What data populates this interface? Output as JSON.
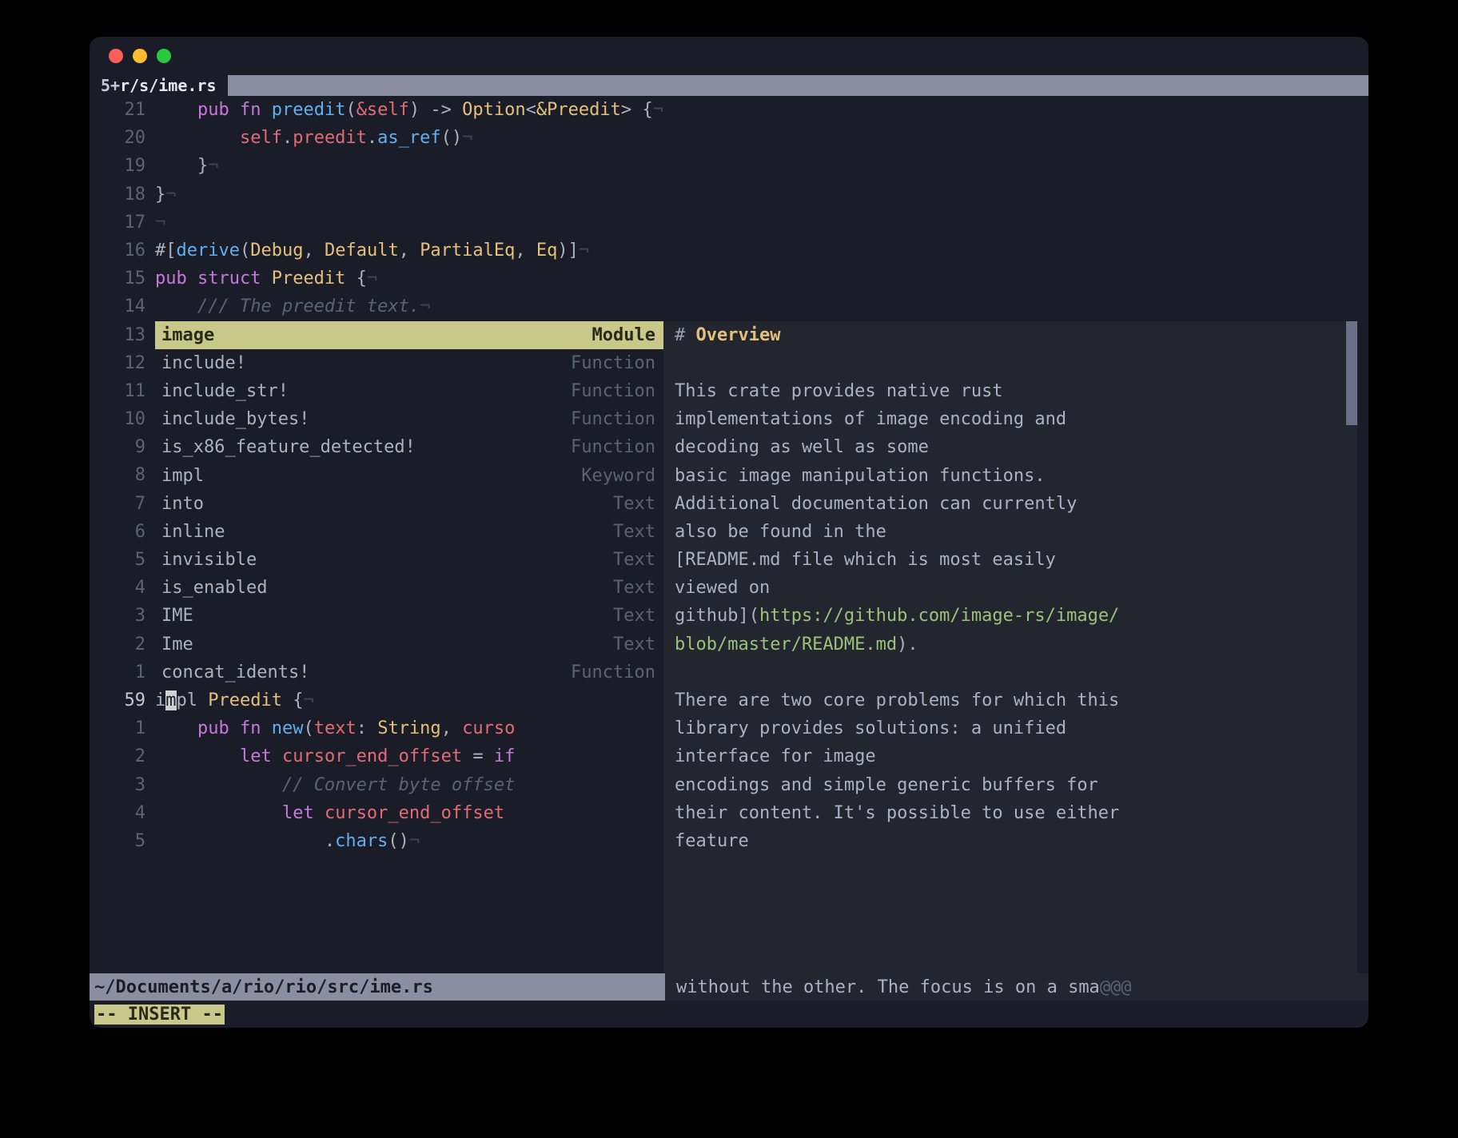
{
  "tab": {
    "prefix": "5+ ",
    "path": "r/s/ime.rs"
  },
  "code": {
    "before": [
      {
        "n": "21",
        "tokens": [
          [
            "plain",
            "    "
          ],
          [
            "kw",
            "pub fn"
          ],
          [
            "plain",
            " "
          ],
          [
            "fn",
            "preedit"
          ],
          [
            "punct",
            "("
          ],
          [
            "self",
            "&self"
          ],
          [
            "punct",
            ") -> "
          ],
          [
            "type",
            "Option"
          ],
          [
            "punct",
            "<"
          ],
          [
            "type",
            "&Preedit"
          ],
          [
            "punct",
            "> {"
          ],
          [
            "wspace",
            "¬"
          ]
        ]
      },
      {
        "n": "20",
        "tokens": [
          [
            "plain",
            "        "
          ],
          [
            "self",
            "self"
          ],
          [
            "punct",
            "."
          ],
          [
            "ident",
            "preedit"
          ],
          [
            "punct",
            "."
          ],
          [
            "fn",
            "as_ref"
          ],
          [
            "punct",
            "()"
          ],
          [
            "wspace",
            "¬"
          ]
        ]
      },
      {
        "n": "19",
        "tokens": [
          [
            "plain",
            "    }"
          ],
          [
            "wspace",
            "¬"
          ]
        ]
      },
      {
        "n": "18",
        "tokens": [
          [
            "plain",
            "}"
          ],
          [
            "wspace",
            "¬"
          ]
        ]
      },
      {
        "n": "17",
        "tokens": [
          [
            "wspace",
            "¬"
          ]
        ]
      },
      {
        "n": "16",
        "tokens": [
          [
            "punct",
            "#["
          ],
          [
            "fn",
            "derive"
          ],
          [
            "punct",
            "("
          ],
          [
            "type",
            "Debug"
          ],
          [
            "punct",
            ", "
          ],
          [
            "type",
            "Default"
          ],
          [
            "punct",
            ", "
          ],
          [
            "type",
            "PartialEq"
          ],
          [
            "punct",
            ", "
          ],
          [
            "type",
            "Eq"
          ],
          [
            "punct",
            ")]"
          ],
          [
            "wspace",
            "¬"
          ]
        ]
      },
      {
        "n": "15",
        "tokens": [
          [
            "kw",
            "pub struct"
          ],
          [
            "plain",
            " "
          ],
          [
            "type",
            "Preedit"
          ],
          [
            "plain",
            " {"
          ],
          [
            "wspace",
            "¬"
          ]
        ]
      },
      {
        "n": "14",
        "tokens": [
          [
            "plain",
            "    "
          ],
          [
            "comment",
            "/// The preedit text."
          ],
          [
            "wspace",
            "¬"
          ]
        ]
      }
    ],
    "current": {
      "n": "59",
      "prefix": "i",
      "cursor": "m",
      "rest_tokens": [
        [
          "plain",
          "pl "
        ],
        [
          "type",
          "Preedit"
        ],
        [
          "plain",
          " {"
        ],
        [
          "wspace",
          "¬"
        ]
      ]
    },
    "after": [
      {
        "n": "1",
        "tokens": [
          [
            "plain",
            "    "
          ],
          [
            "kw",
            "pub fn"
          ],
          [
            "plain",
            " "
          ],
          [
            "fn",
            "new"
          ],
          [
            "punct",
            "("
          ],
          [
            "ident",
            "text"
          ],
          [
            "punct",
            ": "
          ],
          [
            "type",
            "String"
          ],
          [
            "punct",
            ", "
          ],
          [
            "ident",
            "curso"
          ]
        ]
      },
      {
        "n": "2",
        "tokens": [
          [
            "plain",
            "        "
          ],
          [
            "kw",
            "let"
          ],
          [
            "plain",
            " "
          ],
          [
            "ident",
            "cursor_end_offset"
          ],
          [
            "plain",
            " = "
          ],
          [
            "kw",
            "if"
          ]
        ]
      },
      {
        "n": "3",
        "tokens": [
          [
            "plain",
            "            "
          ],
          [
            "comment",
            "// Convert byte offset"
          ]
        ]
      },
      {
        "n": "4",
        "tokens": [
          [
            "plain",
            "            "
          ],
          [
            "kw",
            "let"
          ],
          [
            "plain",
            " "
          ],
          [
            "ident",
            "cursor_end_offset"
          ]
        ]
      },
      {
        "n": "5",
        "tokens": [
          [
            "plain",
            "                ."
          ],
          [
            "fn",
            "chars"
          ],
          [
            "punct",
            "()"
          ],
          [
            "wspace",
            "¬"
          ]
        ]
      }
    ]
  },
  "completion": {
    "numbers": [
      "13",
      "12",
      "11",
      "10",
      "9",
      "8",
      "7",
      "6",
      "5",
      "4",
      "3",
      "2",
      "1"
    ],
    "items": [
      {
        "name": "image",
        "kind": "Module",
        "selected": true
      },
      {
        "name": "include!",
        "kind": "Function"
      },
      {
        "name": "include_str!",
        "kind": "Function"
      },
      {
        "name": "include_bytes!",
        "kind": "Function"
      },
      {
        "name": "is_x86_feature_detected!",
        "kind": "Function"
      },
      {
        "name": "impl",
        "kind": "Keyword"
      },
      {
        "name": "into",
        "kind": "Text"
      },
      {
        "name": "inline",
        "kind": "Text"
      },
      {
        "name": "invisible",
        "kind": "Text"
      },
      {
        "name": "is_enabled",
        "kind": "Text"
      },
      {
        "name": "IME",
        "kind": "Text"
      },
      {
        "name": "Ime",
        "kind": "Text"
      },
      {
        "name": "concat_idents!",
        "kind": "Function"
      }
    ]
  },
  "doc": {
    "heading_hash": "# ",
    "heading": "Overview",
    "blank1": "",
    "lines_a": [
      "This crate provides native rust",
      "implementations of image encoding and",
      "decoding as well as some",
      "basic image manipulation functions.",
      "Additional documentation can currently",
      "also be found in the",
      "[README.md file which is most easily",
      "viewed on"
    ],
    "link_prefix": "github](",
    "link_a": "https://github.com/image-rs/image/",
    "link_b": "blob/master/README.md",
    "link_suffix": ").",
    "blank2": "",
    "lines_b": [
      "There are two core problems for which this",
      "library provides solutions: a unified",
      "interface for image",
      "encodings and simple generic buffers for",
      "their content. It's possible to use either",
      "feature"
    ],
    "overflow": "without the other. The focus is on a sma",
    "overflow_fade": "@@@"
  },
  "status": {
    "path": "~/Documents/a/rio/rio/src/ime.rs"
  },
  "mode": "-- INSERT --"
}
